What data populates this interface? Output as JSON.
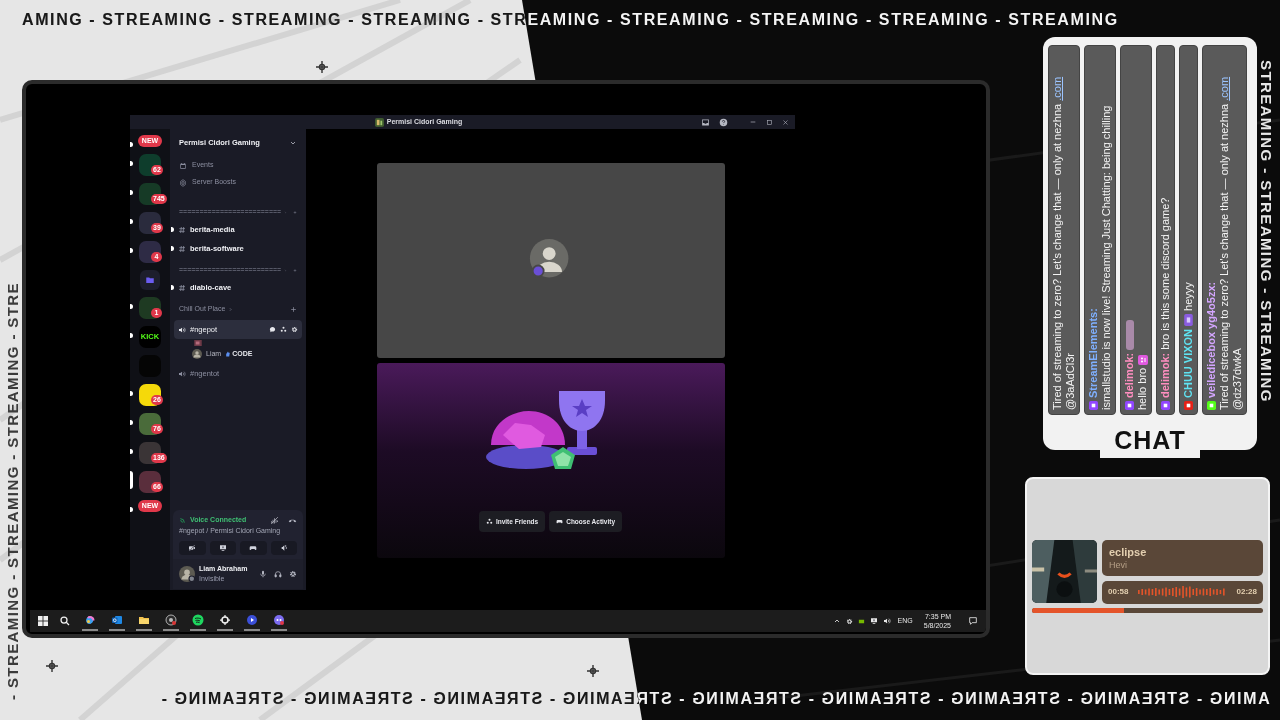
{
  "overlay": {
    "top_banner": "AMING - STREAMING - STREAMING - STREAMING - STREAMING - STREAMING - STREAMING - STREAMING - STREAMING",
    "left_banner": "- STREAMING - STREAMING - STREAMING - STRE",
    "right_banner": "STREAMING - STREAMING - STREAMING",
    "bottom_banner": "AMING - STREAMING - STREAMING - STREAMING - STREAMING - STREAMING - STREAMING - STREAMING - STREAMING -"
  },
  "discord": {
    "window_title": "Permisi Cidori Gaming",
    "server_name": "Permisi Cidori Gaming",
    "servers": [
      {
        "kind": "new",
        "label": "NEW",
        "unread": true,
        "selected": false
      },
      {
        "kind": "server",
        "color": "#0e3d2c",
        "count": "62",
        "unread": true,
        "selected": false
      },
      {
        "kind": "server",
        "color": "#163a26",
        "count": "745",
        "unread": true,
        "selected": false
      },
      {
        "kind": "server",
        "color": "#2a2b3d",
        "count": "39",
        "unread": true,
        "selected": false
      },
      {
        "kind": "server",
        "color": "#2e2b45",
        "count": "4",
        "unread": true,
        "selected": false
      },
      {
        "kind": "folder",
        "color": "#6b5cf0",
        "unread": false,
        "selected": false
      },
      {
        "kind": "server",
        "color": "#1e3a22",
        "count": "1",
        "unread": true,
        "selected": false
      },
      {
        "kind": "server",
        "color": "#000000",
        "label": "KICK",
        "unread": true,
        "selected": false
      },
      {
        "kind": "server",
        "color": "#050505",
        "unread": false,
        "selected": false
      },
      {
        "kind": "server",
        "color": "#f5d90a",
        "count": "26",
        "unread": true,
        "selected": false
      },
      {
        "kind": "server",
        "color": "#4a6b3a",
        "count": "76",
        "unread": true,
        "selected": false
      },
      {
        "kind": "server",
        "color": "#3a3436",
        "count": "136",
        "unread": true,
        "selected": false
      },
      {
        "kind": "server",
        "color": "#5a2e3c",
        "count": "66",
        "unread": false,
        "selected": true
      },
      {
        "kind": "new",
        "label": "NEW",
        "unread": true,
        "selected": false
      }
    ],
    "shortcuts": [
      {
        "kind": "events",
        "label": "Events"
      },
      {
        "kind": "boosts",
        "label": "Server Boosts"
      }
    ],
    "channels": [
      {
        "kind": "category",
        "name": "========================="
      },
      {
        "kind": "text",
        "name": "berita-media",
        "unread": true
      },
      {
        "kind": "text",
        "name": "berita-software",
        "unread": true
      },
      {
        "kind": "category",
        "name": "========================="
      },
      {
        "kind": "text",
        "name": "diablo-cave",
        "unread": true
      },
      {
        "kind": "category",
        "name": "Chill Out Place"
      },
      {
        "kind": "voice",
        "name": "#ngepot",
        "selected": true
      },
      {
        "kind": "user",
        "name": "Liam",
        "badge": "CODE"
      },
      {
        "kind": "voice",
        "name": "#ngentot",
        "selected": false
      }
    ],
    "voice_status": "Voice Connected",
    "voice_location": "#ngepot / Permisi Cidori Gaming",
    "user": {
      "name": "Liam Abraham",
      "status": "Invisible"
    },
    "activity_buttons": [
      "Invite Friends",
      "Choose Activity"
    ]
  },
  "taskbar": {
    "language": "ENG",
    "time": "7:35 PM",
    "date": "5/8/2025"
  },
  "chat": {
    "label": "CHAT",
    "messages": [
      {
        "kind": "plain",
        "text": "Tired of streaming to zero? Let's change that — only at nezhna",
        "link": ".com",
        "mention": "@3aAdCl3r"
      },
      {
        "kind": "twitch",
        "author": "StreamElements:",
        "color": "#7fb0ff",
        "text": "ismallstudio is now live! Streaming Just Chatting: being chilling"
      },
      {
        "kind": "twitch",
        "author": "delimok:",
        "color": "#ff8ec0",
        "emote": true,
        "text": "hello bro"
      },
      {
        "kind": "twitch",
        "author": "delimok:",
        "color": "#ff8ec0",
        "text": "bro is this some discord game?"
      },
      {
        "kind": "youtube",
        "author": "CHUU VIXON",
        "color": "#5fe3f2",
        "badge": true,
        "text": "heyyy"
      },
      {
        "kind": "kick",
        "author": "veiledicebox yg4o5zx:",
        "color": "#d4a6ff",
        "text": "Tired of streaming to zero? Let's change that — only at nezhna",
        "link": ".com",
        "mention": "@dz37dwkA"
      }
    ]
  },
  "music": {
    "title": "eclipse",
    "artist": "Hevi",
    "elapsed": "00:58",
    "duration": "02:28",
    "level": 0.4
  }
}
